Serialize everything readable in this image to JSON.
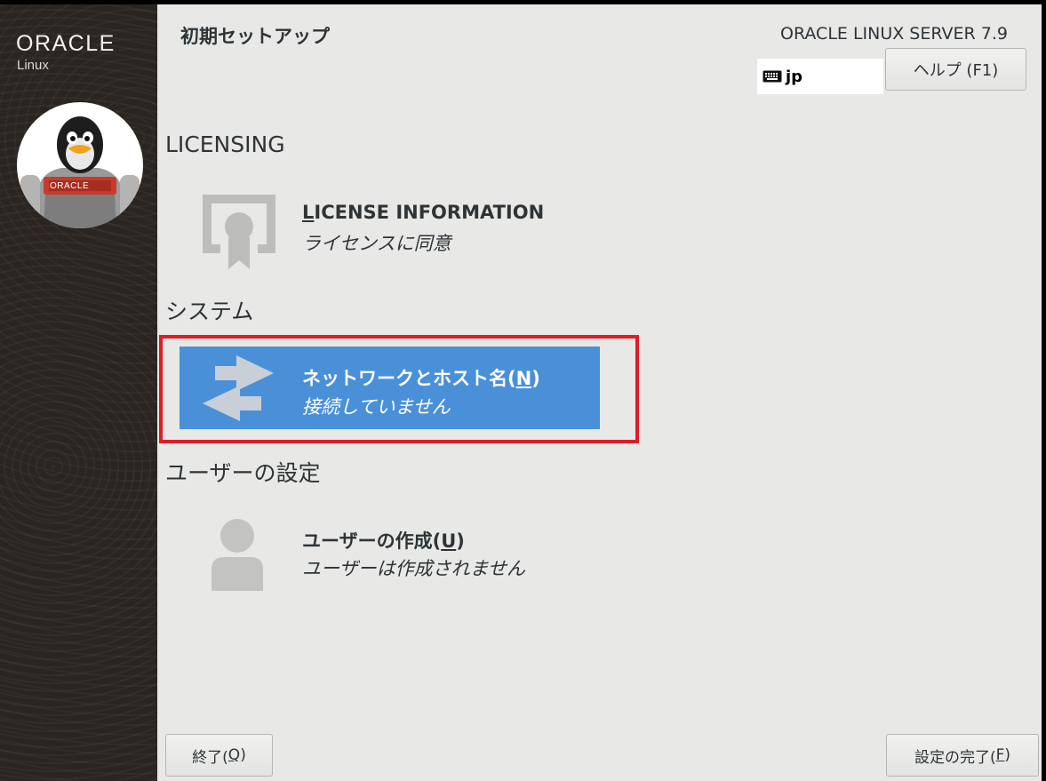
{
  "sidebar": {
    "brand": "ORACLE",
    "brand_sub": "Linux",
    "badge_text": "ORACLE"
  },
  "header": {
    "title": "初期セットアップ",
    "product": "ORACLE LINUX SERVER 7.9",
    "keyboard_layout": "jp",
    "help_button": "ヘルプ (F1)"
  },
  "sections": {
    "licensing": {
      "heading": "LICENSING",
      "spoke": {
        "name_mnemonic": "L",
        "name_rest": "ICENSE INFORMATION",
        "status": "ライセンスに同意"
      }
    },
    "system": {
      "heading": "システム",
      "spoke": {
        "name_prefix": "ネットワークとホスト名(",
        "name_mnemonic": "N",
        "name_suffix": ")",
        "status": "接続していません",
        "selected": true
      }
    },
    "user": {
      "heading": "ユーザーの設定",
      "spoke": {
        "name_prefix": "ユーザーの作成(",
        "name_mnemonic": "U",
        "name_suffix": ")",
        "status": "ユーザーは作成されません"
      }
    }
  },
  "footer": {
    "quit_prefix": "終了(",
    "quit_mnemonic": "Q",
    "quit_suffix": ")",
    "finish_prefix": "設定の完了(",
    "finish_mnemonic": "F",
    "finish_suffix": ")"
  },
  "colors": {
    "selected_bg": "#4a90d9",
    "highlight_border": "#e01b24",
    "sidebar_bg": "#2a2520"
  }
}
